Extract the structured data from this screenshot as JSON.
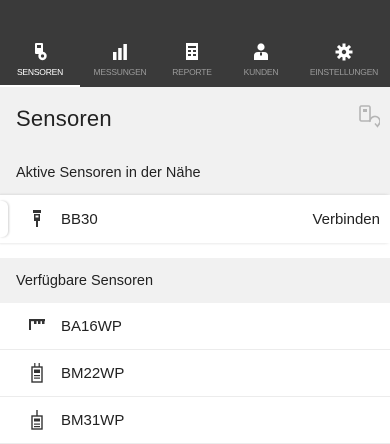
{
  "nav": {
    "tabs": [
      {
        "label": "SENSOREN",
        "icon": "sensor-settings-icon",
        "active": true
      },
      {
        "label": "MESSUNGEN",
        "icon": "bar-chart-icon",
        "active": false
      },
      {
        "label": "REPORTE",
        "icon": "report-icon",
        "active": false
      },
      {
        "label": "KUNDEN",
        "icon": "customers-icon",
        "active": false
      },
      {
        "label": "EINSTELLUNGEN",
        "icon": "gear-icon",
        "active": false
      }
    ]
  },
  "header": {
    "title": "Sensoren",
    "action_icon": "sensor-sync-icon"
  },
  "sections": {
    "nearby": {
      "title": "Aktive Sensoren in der Nähe",
      "items": [
        {
          "name": "BB30",
          "action": "Verbinden",
          "icon": "probe-icon"
        }
      ]
    },
    "available": {
      "title": "Verfügbare Sensoren",
      "items": [
        {
          "name": "BA16WP",
          "icon": "comb-sensor-icon"
        },
        {
          "name": "BM22WP",
          "icon": "meter-icon"
        },
        {
          "name": "BM31WP",
          "icon": "tip-meter-icon"
        }
      ]
    }
  },
  "colors": {
    "topbar": "#3a3a3a",
    "header_bg": "#f1f1f1",
    "active_label": "#ffffff",
    "inactive_label": "#9a9a9a"
  }
}
